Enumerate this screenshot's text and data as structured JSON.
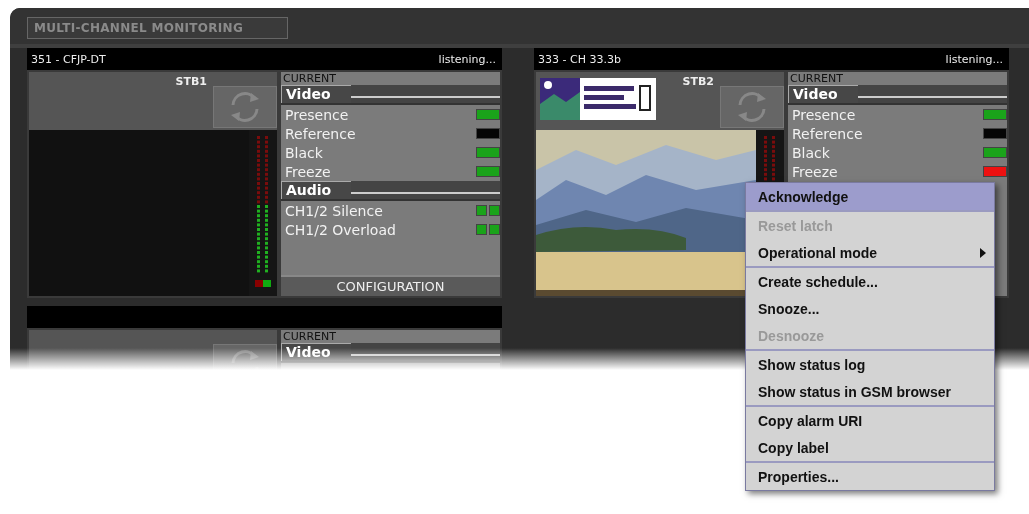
{
  "window": {
    "title": "MULTI-CHANNEL MONITORING"
  },
  "panels": [
    {
      "channel": "351 - CFJP-DT",
      "status": "listening...",
      "stb": "STB1",
      "preview": {
        "kind": "blank"
      },
      "meter": {
        "level": 0.5
      },
      "current_label": "CURRENT",
      "sections": [
        {
          "title": "Video",
          "rows": [
            {
              "label": "Presence",
              "indicators": [
                {
                  "color": "#1aa31a"
                }
              ]
            },
            {
              "label": "Reference",
              "indicators": [
                {
                  "color": "#050505"
                }
              ]
            },
            {
              "label": "Black",
              "indicators": [
                {
                  "color": "#1aa31a"
                }
              ]
            },
            {
              "label": "Freeze",
              "indicators": [
                {
                  "color": "#1aa31a"
                }
              ]
            }
          ]
        },
        {
          "title": "Audio",
          "rows": [
            {
              "label": "CH1/2 Silence",
              "indicators": [
                {
                  "color": "#1aa31a"
                },
                {
                  "color": "#1aa31a"
                }
              ]
            },
            {
              "label": "CH1/2 Overload",
              "indicators": [
                {
                  "color": "#1aa31a"
                },
                {
                  "color": "#1aa31a"
                }
              ]
            }
          ]
        }
      ],
      "button": "CONFIGURATION"
    },
    {
      "channel": "333 - CH 33.3b",
      "status": "listening...",
      "stb": "STB2",
      "preview": {
        "kind": "picture"
      },
      "logo": {
        "kind": "picture"
      },
      "meter_shown": true,
      "current_label": "CURRENT",
      "sections": [
        {
          "title": "Video",
          "rows": [
            {
              "label": "Presence",
              "indicators": [
                {
                  "color": "#1aa31a"
                }
              ]
            },
            {
              "label": "Reference",
              "indicators": [
                {
                  "color": "#050505"
                }
              ]
            },
            {
              "label": "Black",
              "indicators": [
                {
                  "color": "#1aa31a"
                }
              ]
            },
            {
              "label": "Freeze",
              "indicators": [
                {
                  "color": "#ee1111"
                }
              ]
            }
          ]
        }
      ]
    },
    {
      "current_label": "CURRENT",
      "sections": [
        {
          "title": "Video"
        }
      ]
    }
  ],
  "context_menu": {
    "groups": [
      [
        {
          "label": "Acknowledge",
          "selected": true,
          "disabled": false,
          "submenu": false
        }
      ],
      [
        {
          "label": "Reset latch",
          "selected": false,
          "disabled": true,
          "submenu": false
        },
        {
          "label": "Operational mode",
          "selected": false,
          "disabled": false,
          "submenu": true
        }
      ],
      [
        {
          "label": "Create schedule...",
          "selected": false,
          "disabled": false,
          "submenu": false
        },
        {
          "label": "Snooze...",
          "selected": false,
          "disabled": false,
          "submenu": false
        },
        {
          "label": "Desnooze",
          "selected": false,
          "disabled": true,
          "submenu": false
        }
      ],
      [
        {
          "label": "Show status log",
          "selected": false,
          "disabled": false,
          "submenu": false
        },
        {
          "label": "Show status in GSM browser",
          "selected": false,
          "disabled": false,
          "submenu": false
        }
      ],
      [
        {
          "label": "Copy alarm URI",
          "selected": false,
          "disabled": false,
          "submenu": false
        },
        {
          "label": "Copy label",
          "selected": false,
          "disabled": false,
          "submenu": false
        }
      ],
      [
        {
          "label": "Properties...",
          "selected": false,
          "disabled": false,
          "submenu": false
        }
      ]
    ]
  }
}
